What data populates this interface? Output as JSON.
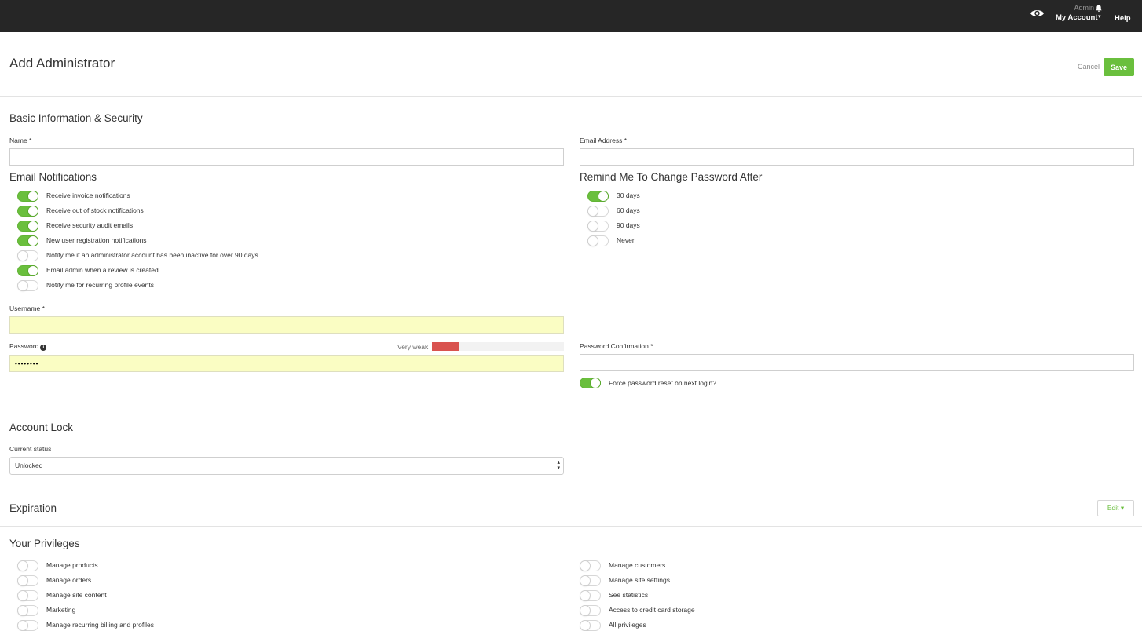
{
  "topbar": {
    "preview_icon": "eye-icon",
    "role": "Admin",
    "bell_icon": "bell-icon",
    "account_label": "My Account",
    "account_caret": "▾",
    "help_label": "Help"
  },
  "header": {
    "title": "Add Administrator",
    "cancel_label": "Cancel",
    "save_label": "Save"
  },
  "basic": {
    "title": "Basic Information & Security",
    "name_label": "Name *",
    "name_value": "",
    "email_label": "Email Address *",
    "email_value": ""
  },
  "notifications": {
    "title": "Email Notifications",
    "items": [
      {
        "label": "Receive invoice notifications",
        "on": true
      },
      {
        "label": "Receive out of stock notifications",
        "on": true
      },
      {
        "label": "Receive security audit emails",
        "on": true
      },
      {
        "label": "New user registration notifications",
        "on": true
      },
      {
        "label": "Notify me if an administrator account has been inactive for over 90 days",
        "on": false
      },
      {
        "label": "Email admin when a review is created",
        "on": true
      },
      {
        "label": "Notify me for recurring profile events",
        "on": false
      }
    ]
  },
  "remind": {
    "title": "Remind Me To Change Password After",
    "items": [
      {
        "label": "30 days",
        "on": true
      },
      {
        "label": "60 days",
        "on": false
      },
      {
        "label": "90 days",
        "on": false
      },
      {
        "label": "Never",
        "on": false
      }
    ]
  },
  "credentials": {
    "username_label": "Username *",
    "username_value": "",
    "password_label": "Password",
    "password_info_icon": "info-icon",
    "password_value": "••••••••",
    "strength_label": "Very weak",
    "strength_level": 0.2,
    "strength_color": "#d9534f",
    "confirm_label": "Password Confirmation *",
    "confirm_value": "",
    "force_reset_label": "Force password reset on next login?",
    "force_reset_on": true
  },
  "account_lock": {
    "title": "Account Lock",
    "status_label": "Current status",
    "status_value": "Unlocked"
  },
  "expiration": {
    "title": "Expiration",
    "edit_label": "Edit ▾"
  },
  "privileges": {
    "title": "Your Privileges",
    "left": [
      {
        "label": "Manage products",
        "on": false
      },
      {
        "label": "Manage orders",
        "on": false
      },
      {
        "label": "Manage site content",
        "on": false
      },
      {
        "label": "Marketing",
        "on": false
      },
      {
        "label": "Manage recurring billing and profiles",
        "on": false
      }
    ],
    "right": [
      {
        "label": "Manage customers",
        "on": false
      },
      {
        "label": "Manage site settings",
        "on": false
      },
      {
        "label": "See statistics",
        "on": false
      },
      {
        "label": "Access to credit card storage",
        "on": false
      },
      {
        "label": "All privileges",
        "on": false
      }
    ]
  },
  "colors": {
    "topbar": "#262626",
    "accent_green": "#6abf3d",
    "autofill_yellow": "#fafdc3"
  }
}
